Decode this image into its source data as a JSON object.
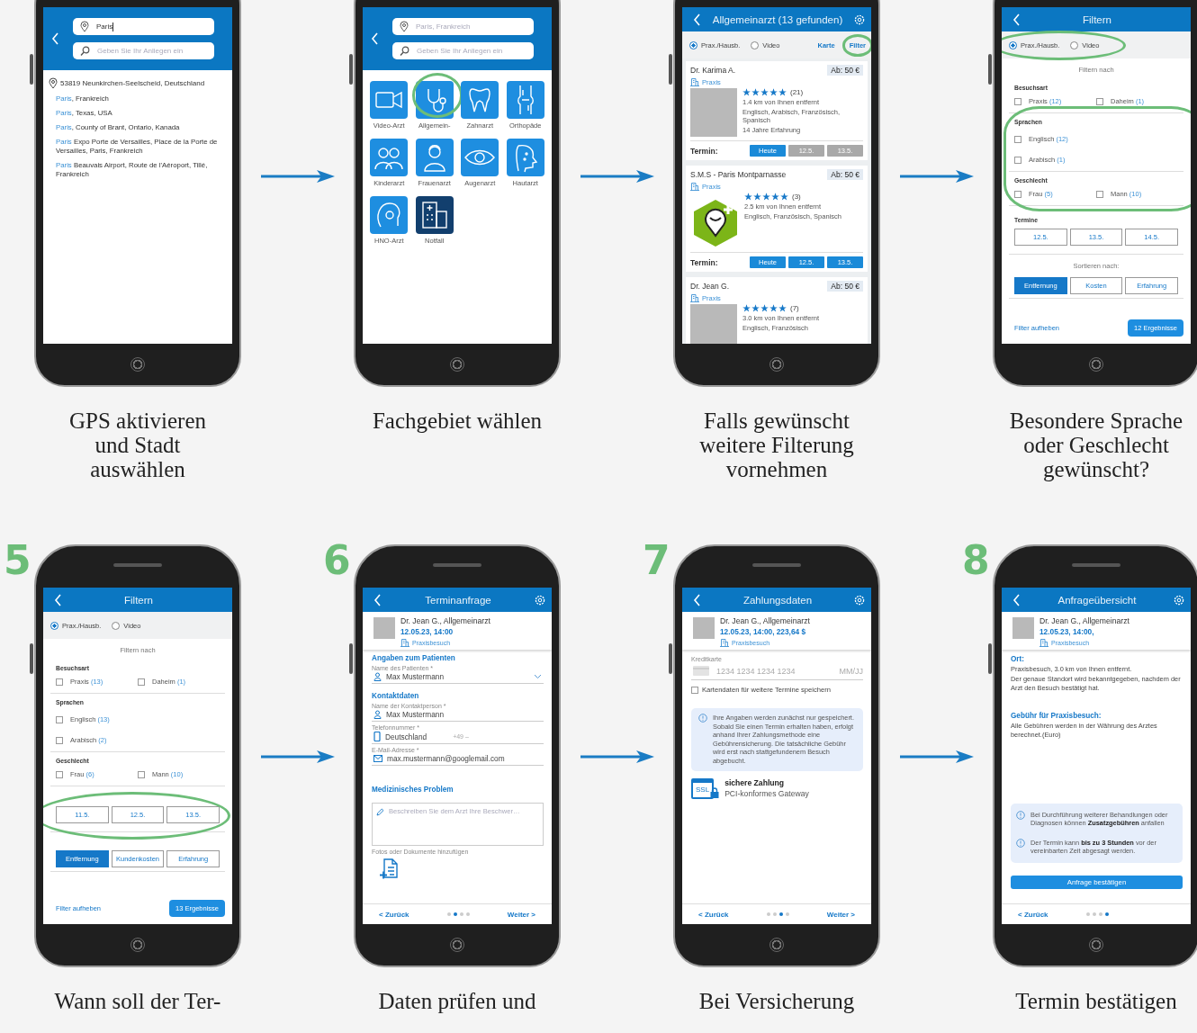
{
  "rows": [
    {
      "steps": [
        {
          "caption": "GPS aktivieren\nund Stadt\nauswählen",
          "screen": {
            "kind": "location_search",
            "location_field": {
              "value": "Paris"
            },
            "search_field": {
              "placeholder": "Geben Sie Ihr Anliegen ein"
            },
            "current_location": "53819 Neunkirchen-Seelscheid, Deutschland",
            "suggestions": [
              {
                "match": "Paris",
                "rest": ", Frankreich"
              },
              {
                "match": "Paris",
                "rest": ", Texas, USA"
              },
              {
                "match": "Paris",
                "rest": ", County of Brant, Ontario, Kanada"
              },
              {
                "match": "Paris",
                "rest": " Expo Porte de Versailles, Place de la Porte de Versailles, Paris, Frankreich"
              },
              {
                "match": "Paris",
                "rest": " Beauvais Airport, Route de l'Aéroport, Tillé, Frankreich"
              }
            ]
          }
        },
        {
          "caption": "Fachgebiet wählen",
          "screen": {
            "kind": "specialties",
            "location_field": {
              "placeholder": "Paris, Frankreich"
            },
            "search_field": {
              "placeholder": "Geben Sie Ihr Anliegen ein"
            },
            "specialties": [
              {
                "label": "Video-Arzt",
                "kind": "standard",
                "circled": false
              },
              {
                "label": "Allgemein-",
                "kind": "standard",
                "circled": true
              },
              {
                "label": "Zahnarzt",
                "kind": "standard",
                "circled": false
              },
              {
                "label": "Orthopäde",
                "kind": "standard",
                "circled": false
              },
              {
                "label": "Kinderarzt",
                "kind": "standard",
                "circled": false
              },
              {
                "label": "Frauenarzt",
                "kind": "standard",
                "circled": false
              },
              {
                "label": "Augenarzt",
                "kind": "standard",
                "circled": false
              },
              {
                "label": "Hautarzt",
                "kind": "standard",
                "circled": false
              },
              {
                "label": "HNO-Arzt",
                "kind": "standard",
                "circled": false
              },
              {
                "label": "Notfall",
                "kind": "emergency",
                "circled": false
              }
            ]
          }
        },
        {
          "caption": "Falls gewünscht\nweitere Filterung\nvornehmen",
          "screen": {
            "kind": "results",
            "title": "Allgemeinarzt (13 gefunden)",
            "modes_circled": false,
            "modes": [
              {
                "label": "Prax./Hausb.",
                "selected": true
              },
              {
                "label": "Video",
                "selected": false
              }
            ],
            "view_links": [
              {
                "label": "Karte",
                "circled": false
              },
              {
                "label": "Filter",
                "circled": true
              }
            ],
            "doctors": [
              {
                "name": "Dr. Karima A.",
                "price": "Ab: 50 €",
                "type": "Praxis",
                "kind": "photo",
                "stars": 5,
                "reviews": "(21)",
                "distance": "1.4 km von Ihnen entfernt",
                "languages": "Englisch, Arabisch, Französisch, Spanisch",
                "experience": "14 Jahre Erfahrung",
                "termin_label": "Termin:",
                "slots": [
                  {
                    "label": "Heute",
                    "available": true
                  },
                  {
                    "label": "12.5.",
                    "available": false
                  },
                  {
                    "label": "13.5.",
                    "available": false
                  }
                ]
              },
              {
                "name": "S.M.S - Paris Montparnasse",
                "price": "Ab: 50 €",
                "type": "Praxis",
                "kind": "logo",
                "stars": 5,
                "reviews": "(3)",
                "distance": "2.5 km von Ihnen entfernt",
                "languages": "Englisch, Französisch, Spanisch",
                "termin_label": "Termin:",
                "slots": [
                  {
                    "label": "Heute",
                    "available": true
                  },
                  {
                    "label": "12.5.",
                    "available": true
                  },
                  {
                    "label": "13.5.",
                    "available": true
                  }
                ]
              },
              {
                "name": "Dr. Jean G.",
                "price": "Ab: 50 €",
                "type": "Praxis",
                "kind": "photo",
                "stars": 5,
                "reviews": "(7)",
                "distance": "3.0 km von Ihnen entfernt",
                "languages": "Englisch, Französisch"
              }
            ]
          }
        },
        {
          "caption": "Besondere Sprache\noder Geschlecht\ngewünscht?",
          "screen": {
            "kind": "filter",
            "title": "Filtern",
            "modes_circled": true,
            "modes": [
              {
                "label": "Prax./Hausb.",
                "selected": true
              },
              {
                "label": "Video",
                "selected": false
              }
            ],
            "filter_heading": "Filtern nach",
            "sections": [
              {
                "title": "Besuchsart",
                "kind": "columns",
                "circled": false,
                "options": [
                  {
                    "label": "Praxis",
                    "count": "(12)",
                    "checked": false
                  },
                  {
                    "label": "Daheim",
                    "count": "(1)",
                    "checked": false
                  }
                ]
              },
              {
                "title": "Sprachen",
                "kind": "list",
                "circled": true,
                "options": [
                  {
                    "label": "Englisch",
                    "count": "(12)",
                    "checked": false
                  },
                  {
                    "label": "Arabisch",
                    "count": "(1)",
                    "checked": false
                  }
                ]
              },
              {
                "title": "Geschlecht",
                "kind": "columns",
                "circled": true,
                "options": [
                  {
                    "label": "Frau",
                    "count": "(5)",
                    "checked": false
                  },
                  {
                    "label": "Mann",
                    "count": "(10)",
                    "checked": false
                  }
                ]
              }
            ],
            "dates": {
              "title": "Termine",
              "circled": false,
              "options": [
                {
                  "label": "12.5.",
                  "selected": false
                },
                {
                  "label": "13.5.",
                  "selected": false
                },
                {
                  "label": "14.5.",
                  "selected": false
                }
              ]
            },
            "sort": {
              "title": "Sortieren nach:",
              "options": [
                {
                  "label": "Entfernung",
                  "selected": true
                },
                {
                  "label": "Kosten",
                  "selected": false
                },
                {
                  "label": "Erfahrung",
                  "selected": false
                }
              ]
            },
            "reset_link": "Filter aufheben",
            "results_button": "12 Ergebnisse"
          }
        }
      ]
    },
    {
      "steps": [
        {
          "number": "5",
          "caption": "Wann soll der Ter-",
          "screen": {
            "kind": "filter",
            "title": "Filtern",
            "modes_circled": false,
            "modes": [
              {
                "label": "Prax./Hausb.",
                "selected": true
              },
              {
                "label": "Video",
                "selected": false
              }
            ],
            "filter_heading": "Filtern nach",
            "sections": [
              {
                "title": "Besuchsart",
                "kind": "columns",
                "circled": false,
                "options": [
                  {
                    "label": "Praxis",
                    "count": "(13)",
                    "checked": false
                  },
                  {
                    "label": "Daheim",
                    "count": "(1)",
                    "checked": false
                  }
                ]
              },
              {
                "title": "Sprachen",
                "kind": "list",
                "circled": false,
                "options": [
                  {
                    "label": "Englisch",
                    "count": "(13)",
                    "checked": false
                  },
                  {
                    "label": "Arabisch",
                    "count": "(2)",
                    "checked": false
                  }
                ]
              },
              {
                "title": "Geschlecht",
                "kind": "columns",
                "circled": false,
                "options": [
                  {
                    "label": "Frau",
                    "count": "(6)",
                    "checked": false
                  },
                  {
                    "label": "Mann",
                    "count": "(10)",
                    "checked": false
                  }
                ]
              }
            ],
            "dates": {
              "circled": true,
              "options": [
                {
                  "label": "11.5.",
                  "selected": false
                },
                {
                  "label": "12.5.",
                  "selected": false
                },
                {
                  "label": "13.5.",
                  "selected": false
                }
              ]
            },
            "sort": {
              "options": [
                {
                  "label": "Entfernung",
                  "selected": true
                },
                {
                  "label": "Kundenkosten",
                  "selected": false
                },
                {
                  "label": "Erfahrung",
                  "selected": false
                }
              ]
            },
            "reset_link": "Filter aufheben",
            "results_button": "13 Ergebnisse"
          }
        },
        {
          "number": "6",
          "caption": "Daten prüfen und",
          "screen": {
            "kind": "request",
            "title": "Terminanfrage",
            "doctor": {
              "name": "Dr. Jean G., Allgemeinarzt",
              "datetime": "12.05.23, 14:00",
              "visit": "Praxisbesuch"
            },
            "groups": [
              {
                "heading": "Angaben zum Patienten",
                "fields": [
                  {
                    "kind": "person",
                    "label": "Name des Patienten *",
                    "value": "Max Mustermann",
                    "dropdown": true
                  }
                ]
              },
              {
                "heading": "Kontaktdaten",
                "fields": [
                  {
                    "kind": "person",
                    "label": "Name der Kontaktperson *",
                    "value": "Max Mustermann",
                    "dropdown": false
                  },
                  {
                    "kind": "phone",
                    "label": "Telefonnummer *",
                    "value": "Deutschland",
                    "prefix": "+49 –",
                    "dropdown": false
                  },
                  {
                    "kind": "email",
                    "label": "E-Mail-Adresse *",
                    "value": "max.mustermann@googlemail.com",
                    "dropdown": false
                  }
                ]
              }
            ],
            "problem": {
              "heading": "Medizinisches Problem",
              "placeholder": "Beschreiben Sie dem Arzt Ihre Beschwer…",
              "attach_label": "Fotos oder Dokumente hinzufügen"
            },
            "nav": {
              "back": "< Zurück",
              "next": "Weiter >",
              "pages": [
                {
                  "selected": false
                },
                {
                  "selected": true
                },
                {
                  "selected": false
                },
                {
                  "selected": false
                }
              ]
            }
          }
        },
        {
          "number": "7",
          "caption": "Bei Versicherung",
          "screen": {
            "kind": "payment",
            "title": "Zahlungsdaten",
            "doctor": {
              "name": "Dr. Jean G., Allgemeinarzt",
              "datetime": "12.05.23, 14:00, 223,64 $",
              "visit": "Praxisbesuch"
            },
            "card": {
              "label": "Kreditkarte",
              "number_placeholder": "1234 1234 1234 1234",
              "expiry_placeholder": "MM/JJ"
            },
            "save_card": {
              "label": "Kartendaten für weitere Termine speichern",
              "checked": false
            },
            "info": "Ihre Angaben werden zunächst nur gespeichert. Sobald Sie einen Termin erhalten haben, erfolgt anhand Ihrer Zahlungsmethode eine Gebührensicherung. Die tatsächliche Gebühr wird erst nach stattgefundenem Besuch abgebucht.",
            "secure": {
              "badge": "SSL",
              "title": "sichere Zahlung",
              "subtitle": "PCI-konformes Gateway"
            },
            "nav": {
              "back": "< Zurück",
              "next": "Weiter >",
              "pages": [
                {
                  "selected": false
                },
                {
                  "selected": false
                },
                {
                  "selected": true
                },
                {
                  "selected": false
                }
              ]
            }
          }
        },
        {
          "number": "8",
          "caption": "Termin bestätigen",
          "screen": {
            "kind": "summary",
            "title": "Anfrageübersicht",
            "doctor": {
              "name": "Dr. Jean G., Allgemeinarzt",
              "datetime": "12.05.23, 14:00,",
              "visit": "Praxisbesuch"
            },
            "blocks": [
              {
                "heading": "Ort:",
                "paragraphs": [
                  "Praxisbesuch, 3.0 km von Ihnen entfernt.",
                  "Der genaue Standort wird bekanntgegeben, nachdem der Arzt den Besuch bestätigt hat."
                ]
              },
              {
                "heading": "Gebühr für Praxisbesuch:",
                "paragraphs": [
                  "Alle Gebühren werden in der Währung des Arztes berechnet.(Euro)"
                ]
              }
            ],
            "notes": [
              "Bei Durchführung weiterer Behandlungen oder Diagnosen können **Zusatzgebühren** anfallen",
              "Der Termin kann **bis zu 3 Stunden** vor der vereinbarten Zeit abgesagt werden."
            ],
            "confirm_button": "Anfrage bestätigen",
            "nav": {
              "back": "< Zurück",
              "pages": [
                {
                  "selected": false
                },
                {
                  "selected": false
                },
                {
                  "selected": false
                },
                {
                  "selected": true
                }
              ]
            }
          }
        }
      ]
    }
  ]
}
